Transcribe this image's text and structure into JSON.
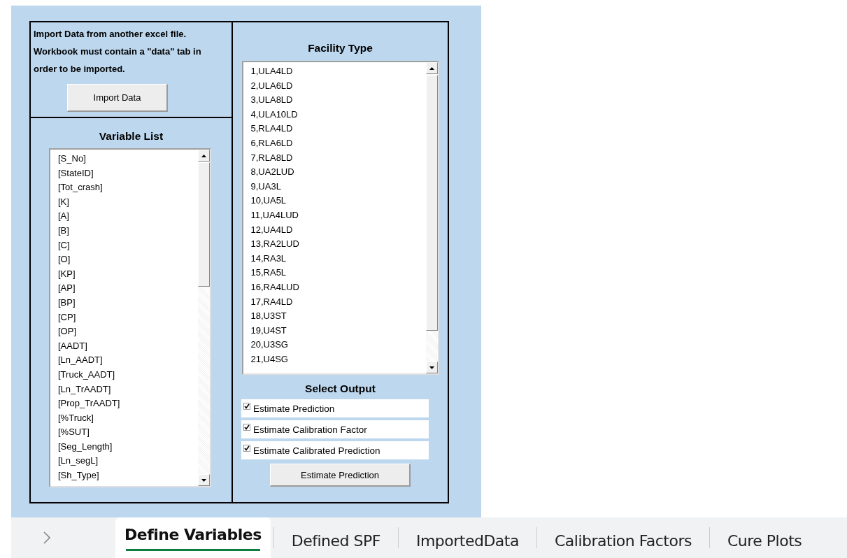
{
  "import_section": {
    "instructions": "Import Data from another excel file. Workbook must contain a \"data\" tab in order to be imported.",
    "button": "Import Data"
  },
  "variable_list": {
    "title": "Variable List",
    "items": [
      "[S_No]",
      "[StateID]",
      "[Tot_crash]",
      "[K]",
      "[A]",
      "[B]",
      "[C]",
      "[O]",
      "[KP]",
      "[AP]",
      "[BP]",
      "[CP]",
      "[OP]",
      "[AADT]",
      "[Ln_AADT]",
      "[Truck_AADT]",
      "[Ln_TrAADT]",
      "[Prop_TrAADT]",
      "[%Truck]",
      "[%SUT]",
      "[Seg_Length]",
      "[Ln_segL]",
      "[Sh_Type]"
    ]
  },
  "facility_type": {
    "title": "Facility Type",
    "items": [
      "1,ULA4LD",
      "2,ULA6LD",
      "3,ULA8LD",
      "4,ULA10LD",
      "5,RLA4LD",
      "6,RLA6LD",
      "7,RLA8LD",
      "8,UA2LUD",
      "9,UA3L",
      "10,UA5L",
      "11,UA4LUD",
      "12,UA4LD",
      "13,RA2LUD",
      "14,RA3L",
      "15,RA5L",
      "16,RA4LUD",
      "17,RA4LD",
      "18,U3ST",
      "19,U4ST",
      "20,U3SG",
      "21,U4SG"
    ]
  },
  "select_output": {
    "title": "Select Output",
    "options": [
      {
        "label": "Estimate Prediction",
        "checked": true
      },
      {
        "label": "Estimate Calibration Factor",
        "checked": true
      },
      {
        "label": "Estimate Calibrated Prediction",
        "checked": true
      }
    ],
    "button": "Estimate Prediction"
  },
  "sheet_tabs": [
    {
      "label": "Define Variables",
      "selected": true
    },
    {
      "label": "Defined SPF",
      "selected": false
    },
    {
      "label": "ImportedData",
      "selected": false
    },
    {
      "label": "Calibration Factors",
      "selected": false
    },
    {
      "label": "Cure Plots",
      "selected": false
    }
  ]
}
